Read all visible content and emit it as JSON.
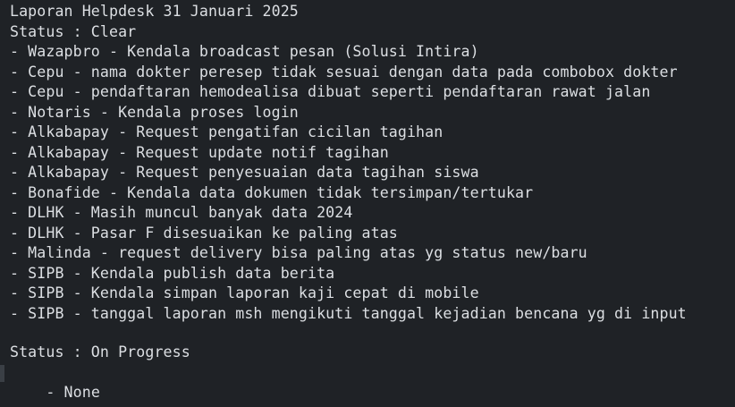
{
  "document": {
    "title": "Laporan Helpdesk 31 Januari 2025",
    "sections": [
      {
        "status": "Status : Clear",
        "items": [
          "- Wazapbro - Kendala broadcast pesan (Solusi Intira)",
          "- Cepu - nama dokter peresep tidak sesuai dengan data pada combobox dokter",
          "- Cepu - pendaftaran hemodealisa dibuat seperti pendaftaran rawat jalan",
          "- Notaris - Kendala proses login",
          "- Alkabapay - Request pengatifan cicilan tagihan",
          "- Alkabapay - Request update notif tagihan",
          "- Alkabapay - Request penyesuaian data tagihan siswa",
          "- Bonafide - Kendala data dokumen tidak tersimpan/tertukar",
          "- DLHK - Masih muncul banyak data 2024",
          "- DLHK - Pasar F disesuaikan ke paling atas",
          "- Malinda - request delivery bisa paling atas yg status new/baru",
          "- SIPB - Kendala publish data berita",
          "- SIPB - Kendala simpan laporan kaji cepat di mobile",
          "- SIPB - tanggal laporan msh mengikuti tanggal kejadian bencana yg di input"
        ]
      },
      {
        "status": "Status : On Progress",
        "items": [
          "- None"
        ]
      }
    ]
  },
  "colors": {
    "background": "#1f2226",
    "text": "#dcdfe3"
  }
}
